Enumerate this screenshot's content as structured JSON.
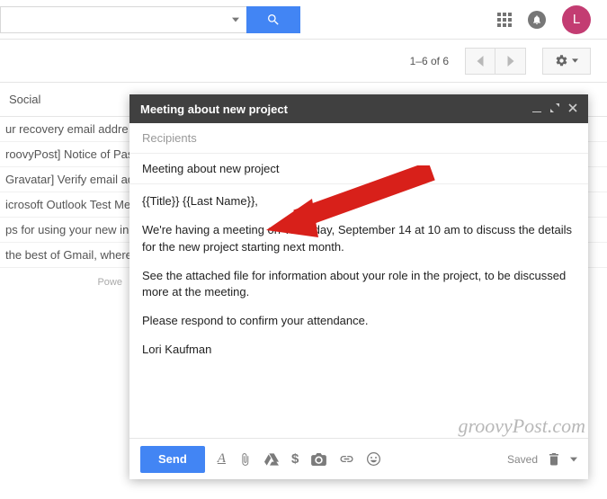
{
  "search": {
    "placeholder": ""
  },
  "avatar_initial": "L",
  "pagination": "1–6 of 6",
  "tab": {
    "social": "Social"
  },
  "inbox_rows": [
    "ur recovery email addre",
    "roovyPost] Notice of Pas",
    "Gravatar] Verify email add",
    "icrosoft Outlook Test Mes",
    "ps for using your new inb",
    "the best of Gmail, wherev"
  ],
  "footer_small": "Powe",
  "compose": {
    "title": "Meeting about new project",
    "recipients_label": "Recipients",
    "subject": "Meeting about new project",
    "body_greeting": "{{Title}} {{Last Name}},",
    "body_p1": "We're having a meeting on Thursday, September 14 at 10 am to discuss the details for the new project starting next month.",
    "body_p2": "See the attached file for information about your role in the project, to be discussed more at the meeting.",
    "body_p3": "Please respond to confirm your attendance.",
    "body_sig": "Lori Kaufman",
    "send": "Send",
    "saved": "Saved"
  },
  "watermark": "groovyPost.com"
}
